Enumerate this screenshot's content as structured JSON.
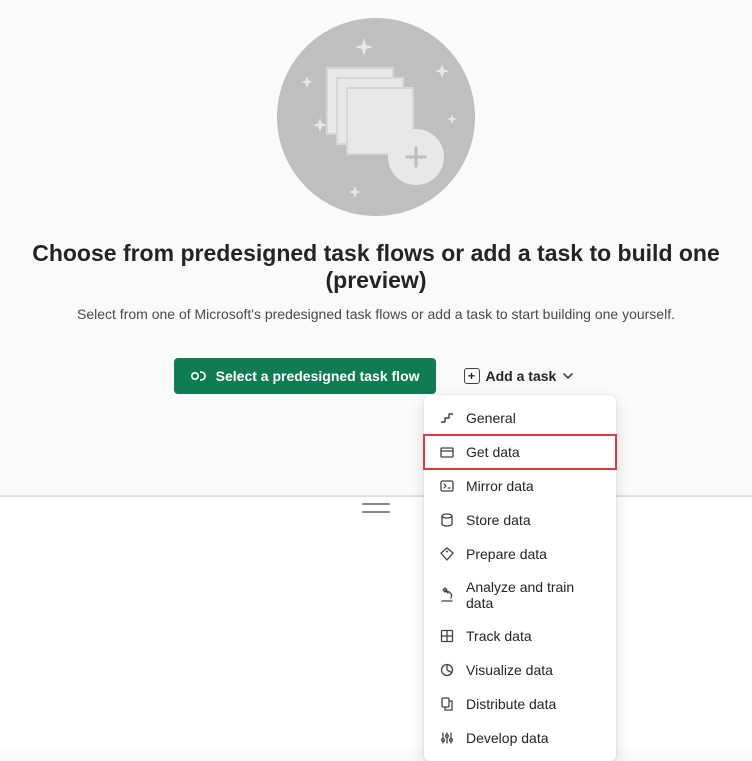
{
  "heading": "Choose from predesigned task flows or add a task to build one (preview)",
  "subheading": "Select from one of Microsoft's predesigned task flows or add a task to start building one yourself.",
  "primary_button_label": "Select a predesigned task flow",
  "secondary_button_label": "Add a task",
  "menu": {
    "items": [
      {
        "icon": "step-icon",
        "label": "General"
      },
      {
        "icon": "folder-icon",
        "label": "Get data"
      },
      {
        "icon": "mirror-icon",
        "label": "Mirror data"
      },
      {
        "icon": "cylinder-icon",
        "label": "Store data"
      },
      {
        "icon": "tag-icon",
        "label": "Prepare data"
      },
      {
        "icon": "microscope-icon",
        "label": "Analyze and train data"
      },
      {
        "icon": "grid-icon",
        "label": "Track data"
      },
      {
        "icon": "pie-icon",
        "label": "Visualize data"
      },
      {
        "icon": "distribute-icon",
        "label": "Distribute data"
      },
      {
        "icon": "tools-icon",
        "label": "Develop data"
      }
    ],
    "highlighted_index": 1
  }
}
